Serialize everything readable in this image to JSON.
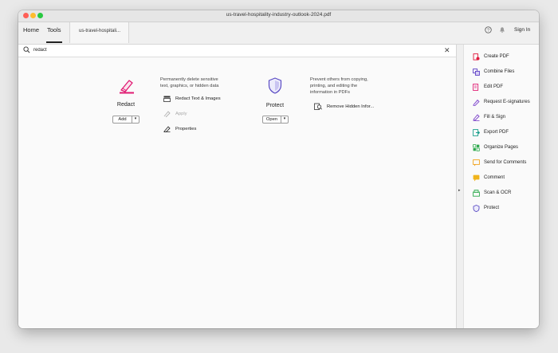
{
  "window": {
    "title": "us-travel-hospitality-industry-outlook-2024.pdf"
  },
  "nav": {
    "home": "Home",
    "tools": "Tools",
    "doc_tab": "us-travel-hospitali..."
  },
  "header": {
    "sign_in": "Sign In"
  },
  "search": {
    "value": "redact"
  },
  "redact": {
    "name": "Redact",
    "description_lines": [
      "Permanently delete sensitive",
      "text, graphics, or hidden data"
    ],
    "button_label": "Add",
    "actions": [
      "Redact Text & Images",
      "Apply",
      "Properties"
    ]
  },
  "protect": {
    "name": "Protect",
    "description_lines": [
      "Prevent others from copying,",
      "printing, and editing the",
      "information in PDFs"
    ],
    "button_label": "Open",
    "actions": [
      "Remove Hidden Infor..."
    ]
  },
  "right_panel": {
    "items": [
      {
        "label": "Create PDF",
        "icon": "create-pdf-icon",
        "color": "#e0183c"
      },
      {
        "label": "Combine Files",
        "icon": "combine-files-icon",
        "color": "#5b3cc4"
      },
      {
        "label": "Edit PDF",
        "icon": "edit-pdf-icon",
        "color": "#e01a72"
      },
      {
        "label": "Request E-signatures",
        "icon": "request-esign-icon",
        "color": "#7a3fc9"
      },
      {
        "label": "Fill & Sign",
        "icon": "fill-sign-icon",
        "color": "#7a3fc9"
      },
      {
        "label": "Export PDF",
        "icon": "export-pdf-icon",
        "color": "#1a9e8c"
      },
      {
        "label": "Organize Pages",
        "icon": "organize-pages-icon",
        "color": "#2aa84a"
      },
      {
        "label": "Send for Comments",
        "icon": "send-comments-icon",
        "color": "#f0a21c"
      },
      {
        "label": "Comment",
        "icon": "comment-icon",
        "color": "#f0b41c"
      },
      {
        "label": "Scan & OCR",
        "icon": "scan-ocr-icon",
        "color": "#2aa84a"
      },
      {
        "label": "Protect",
        "icon": "protect-icon",
        "color": "#5b4cc4"
      }
    ]
  },
  "colors": {
    "accent": "#e01a72",
    "protect": "#5b4cc4"
  }
}
